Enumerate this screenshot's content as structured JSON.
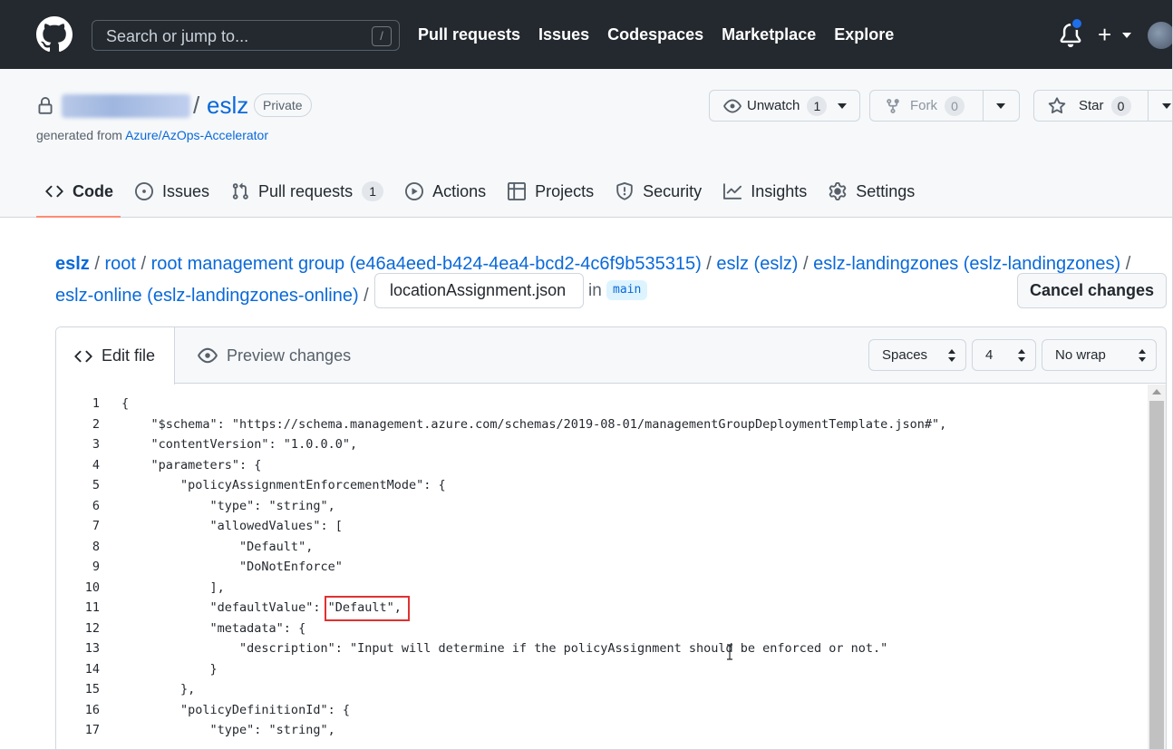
{
  "header": {
    "search_placeholder": "Search or jump to...",
    "search_shortcut": "/",
    "nav": [
      "Pull requests",
      "Issues",
      "Codespaces",
      "Marketplace",
      "Explore"
    ]
  },
  "repo": {
    "separator": "/",
    "name": "eslz",
    "visibility": "Private",
    "generated_prefix": "generated from ",
    "generated_link": "Azure/AzOps-Accelerator",
    "unwatch_label": "Unwatch",
    "unwatch_count": "1",
    "fork_label": "Fork",
    "fork_count": "0",
    "star_label": "Star",
    "star_count": "0"
  },
  "tabs": [
    {
      "label": "Code"
    },
    {
      "label": "Issues"
    },
    {
      "label": "Pull requests",
      "count": "1"
    },
    {
      "label": "Actions"
    },
    {
      "label": "Projects"
    },
    {
      "label": "Security"
    },
    {
      "label": "Insights"
    },
    {
      "label": "Settings"
    }
  ],
  "breadcrumb": {
    "root_repo": "eslz",
    "sep": " / ",
    "items": [
      "root",
      "root management group (e46a4eed-b424-4ea4-bcd2-4c6f9b535315)",
      "eslz (eslz)",
      "eslz-landingzones (eslz-landingzones)",
      "eslz-online (eslz-landingzones-online)"
    ],
    "filename": "locationAssignment.json",
    "in_label": "in",
    "branch": "main",
    "cancel_label": "Cancel changes"
  },
  "editor": {
    "edit_tab": "Edit file",
    "preview_tab": "Preview changes",
    "indent_mode": "Spaces",
    "indent_size": "4",
    "wrap_mode": "No wrap",
    "line_numbers": [
      "1",
      "2",
      "3",
      "4",
      "5",
      "6",
      "7",
      "8",
      "9",
      "10",
      "11",
      "12",
      "13",
      "14",
      "15",
      "16",
      "17"
    ],
    "lines": [
      "{",
      "    \"$schema\": \"https://schema.management.azure.com/schemas/2019-08-01/managementGroupDeploymentTemplate.json#\",",
      "    \"contentVersion\": \"1.0.0.0\",",
      "    \"parameters\": {",
      "        \"policyAssignmentEnforcementMode\": {",
      "            \"type\": \"string\",",
      "            \"allowedValues\": [",
      "                \"Default\",",
      "                \"DoNotEnforce\"",
      "            ],",
      "            \"defaultValue\": \"Default\",",
      "            \"metadata\": {",
      "                \"description\": \"Input will determine if the policyAssignment should be enforced or not.\"",
      "            }",
      "        },",
      "        \"policyDefinitionId\": {",
      "            \"type\": \"string\","
    ]
  },
  "colors": {
    "header_bg": "#24292f",
    "link": "#0969da",
    "highlight_box": "#e03131",
    "notification_dot": "#1f6feb"
  }
}
